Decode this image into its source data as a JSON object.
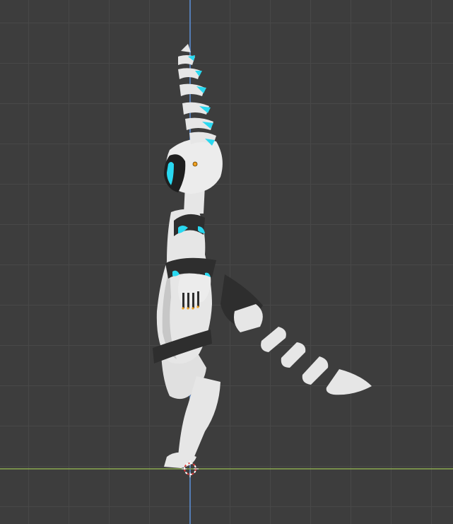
{
  "viewport": {
    "background_color": "#3d3d3d",
    "grid_color": "#484848",
    "x_axis_color": "#8aa84f",
    "z_axis_color": "#5b8fd8",
    "cursor_colors": [
      "#d93b3b",
      "#ffffff"
    ]
  },
  "model": {
    "body_color": "#e6e6e6",
    "shade_color": "#c7c7c7",
    "dark_color": "#2e2e2e",
    "glow_color": "#29d8f0",
    "origin_color": "#f0a020"
  },
  "icons": {
    "cursor": "3d-cursor-icon",
    "origin": "object-origin-icon"
  }
}
